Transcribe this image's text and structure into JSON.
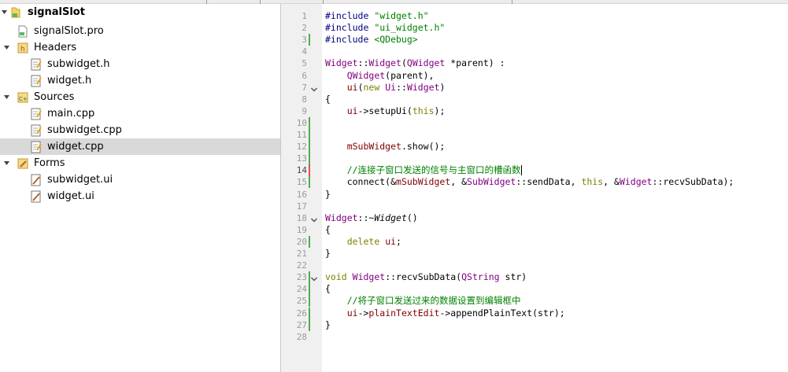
{
  "project": {
    "name": "signalSlot",
    "items": [
      {
        "label": "signalSlot.pro"
      },
      {
        "label": "Headers"
      },
      {
        "label": "subwidget.h"
      },
      {
        "label": "widget.h"
      },
      {
        "label": "Sources"
      },
      {
        "label": "main.cpp"
      },
      {
        "label": "subwidget.cpp"
      },
      {
        "label": "widget.cpp"
      },
      {
        "label": "Forms"
      },
      {
        "label": "subwidget.ui"
      },
      {
        "label": "widget.ui"
      }
    ]
  },
  "editor": {
    "current_line": 14,
    "lines": [
      [
        {
          "t": "#include ",
          "c": "pp"
        },
        {
          "t": "\"widget.h\"",
          "c": "str"
        }
      ],
      [
        {
          "t": "#include ",
          "c": "pp"
        },
        {
          "t": "\"ui_widget.h\"",
          "c": "str"
        }
      ],
      [
        {
          "t": "#include ",
          "c": "pp"
        },
        {
          "t": "<QDebug>",
          "c": "str"
        }
      ],
      [],
      [
        {
          "t": "Widget",
          "c": "typ"
        },
        {
          "t": "::"
        },
        {
          "t": "Widget",
          "c": "typ"
        },
        {
          "t": "("
        },
        {
          "t": "QWidget",
          "c": "typ"
        },
        {
          "t": " *parent) :"
        }
      ],
      [
        {
          "t": "    "
        },
        {
          "t": "QWidget",
          "c": "typ"
        },
        {
          "t": "(parent),"
        }
      ],
      [
        {
          "t": "    "
        },
        {
          "t": "ui",
          "c": "fld"
        },
        {
          "t": "("
        },
        {
          "t": "new",
          "c": "kw"
        },
        {
          "t": " "
        },
        {
          "t": "Ui",
          "c": "typ"
        },
        {
          "t": "::"
        },
        {
          "t": "Widget",
          "c": "typ"
        },
        {
          "t": ")"
        }
      ],
      [
        {
          "t": "{"
        }
      ],
      [
        {
          "t": "    "
        },
        {
          "t": "ui",
          "c": "fld"
        },
        {
          "t": "->setupUi("
        },
        {
          "t": "this",
          "c": "kw"
        },
        {
          "t": ");"
        }
      ],
      [],
      [],
      [
        {
          "t": "    "
        },
        {
          "t": "mSubWidget",
          "c": "fld"
        },
        {
          "t": ".show();"
        }
      ],
      [],
      [
        {
          "t": "    "
        },
        {
          "t": "//连接子窗口发送的信号与主窗口的槽函数",
          "c": "cmt"
        }
      ],
      [
        {
          "t": "    connect(&"
        },
        {
          "t": "mSubWidget",
          "c": "fld"
        },
        {
          "t": ", &"
        },
        {
          "t": "SubWidget",
          "c": "typ"
        },
        {
          "t": "::sendData, "
        },
        {
          "t": "this",
          "c": "kw"
        },
        {
          "t": ", &"
        },
        {
          "t": "Widget",
          "c": "typ"
        },
        {
          "t": "::recvSubData);"
        }
      ],
      [
        {
          "t": "}"
        }
      ],
      [],
      [
        {
          "t": "Widget",
          "c": "typ"
        },
        {
          "t": "::~"
        },
        {
          "t": "Widget",
          "c": "ital"
        },
        {
          "t": "()"
        }
      ],
      [
        {
          "t": "{"
        }
      ],
      [
        {
          "t": "    "
        },
        {
          "t": "delete",
          "c": "kw"
        },
        {
          "t": " "
        },
        {
          "t": "ui",
          "c": "fld"
        },
        {
          "t": ";"
        }
      ],
      [
        {
          "t": "}"
        }
      ],
      [],
      [
        {
          "t": "void",
          "c": "kw"
        },
        {
          "t": " "
        },
        {
          "t": "Widget",
          "c": "typ"
        },
        {
          "t": "::recvSubData("
        },
        {
          "t": "QString",
          "c": "typ"
        },
        {
          "t": " str)"
        }
      ],
      [
        {
          "t": "{"
        }
      ],
      [
        {
          "t": "    "
        },
        {
          "t": "//将子窗口发送过来的数据设置到编辑框中",
          "c": "cmt"
        }
      ],
      [
        {
          "t": "    "
        },
        {
          "t": "ui",
          "c": "fld"
        },
        {
          "t": "->"
        },
        {
          "t": "plainTextEdit",
          "c": "fld"
        },
        {
          "t": "->appendPlainText(str);"
        }
      ],
      [
        {
          "t": "}"
        }
      ],
      []
    ],
    "changed_lines": [
      3,
      10,
      11,
      12,
      13,
      14,
      15,
      20,
      23,
      24,
      25,
      26,
      27
    ],
    "unsaved_lines": [
      14
    ],
    "fold_lines": [
      7,
      18,
      23
    ],
    "colors": {
      "changed_marker": "#4caf50",
      "unsaved_marker": "#e05050",
      "selection": "#d9d9d9",
      "gutter": "#f0f0f0"
    }
  }
}
